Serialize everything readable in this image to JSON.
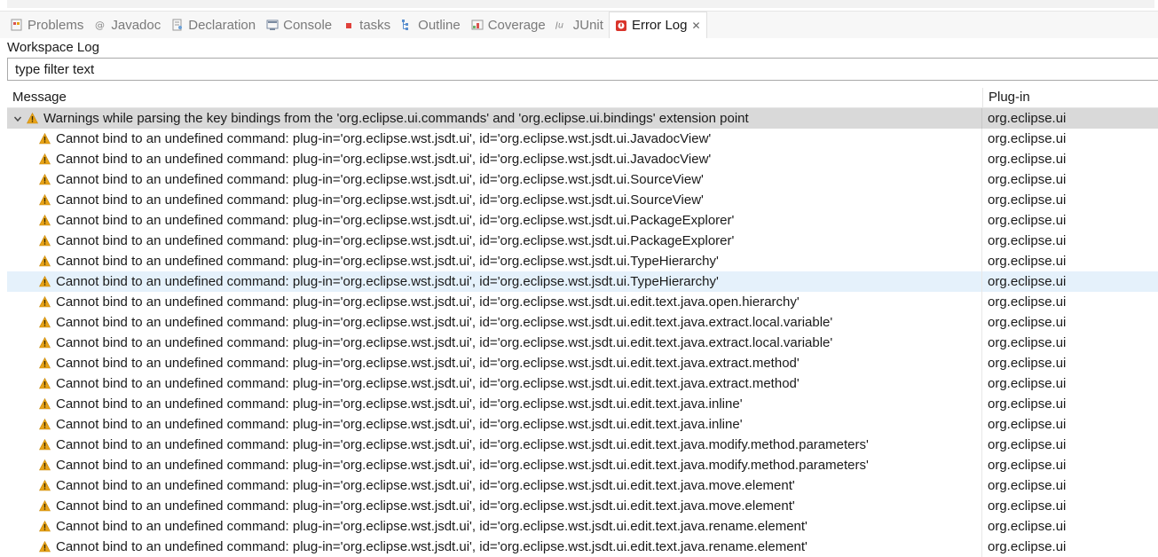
{
  "tabs": [
    {
      "label": "Problems",
      "icon": "problems-icon",
      "active": false
    },
    {
      "label": "Javadoc",
      "icon": "javadoc-icon",
      "active": false
    },
    {
      "label": "Declaration",
      "icon": "declaration-icon",
      "active": false
    },
    {
      "label": "Console",
      "icon": "console-icon",
      "active": false
    },
    {
      "label": "tasks",
      "icon": "tasks-icon",
      "active": false
    },
    {
      "label": "Outline",
      "icon": "outline-icon",
      "active": false
    },
    {
      "label": "Coverage",
      "icon": "coverage-icon",
      "active": false
    },
    {
      "label": "JUnit",
      "icon": "junit-icon",
      "active": false
    },
    {
      "label": "Error Log",
      "icon": "error-log-icon",
      "active": true
    }
  ],
  "panel": {
    "title": "Workspace Log",
    "filter_text": "type filter text"
  },
  "table": {
    "columns": {
      "message": "Message",
      "plugin": "Plug-in"
    },
    "group": {
      "message": "Warnings while parsing the key bindings from the 'org.eclipse.ui.commands' and 'org.eclipse.ui.bindings' extension point",
      "plugin": "org.eclipse.ui",
      "expanded": true
    },
    "rows": [
      {
        "message": "Cannot bind to an undefined command: plug-in='org.eclipse.wst.jsdt.ui', id='org.eclipse.wst.jsdt.ui.JavadocView'",
        "plugin": "org.eclipse.ui"
      },
      {
        "message": "Cannot bind to an undefined command: plug-in='org.eclipse.wst.jsdt.ui', id='org.eclipse.wst.jsdt.ui.JavadocView'",
        "plugin": "org.eclipse.ui"
      },
      {
        "message": "Cannot bind to an undefined command: plug-in='org.eclipse.wst.jsdt.ui', id='org.eclipse.wst.jsdt.ui.SourceView'",
        "plugin": "org.eclipse.ui"
      },
      {
        "message": "Cannot bind to an undefined command: plug-in='org.eclipse.wst.jsdt.ui', id='org.eclipse.wst.jsdt.ui.SourceView'",
        "plugin": "org.eclipse.ui"
      },
      {
        "message": "Cannot bind to an undefined command: plug-in='org.eclipse.wst.jsdt.ui', id='org.eclipse.wst.jsdt.ui.PackageExplorer'",
        "plugin": "org.eclipse.ui"
      },
      {
        "message": "Cannot bind to an undefined command: plug-in='org.eclipse.wst.jsdt.ui', id='org.eclipse.wst.jsdt.ui.PackageExplorer'",
        "plugin": "org.eclipse.ui"
      },
      {
        "message": "Cannot bind to an undefined command: plug-in='org.eclipse.wst.jsdt.ui', id='org.eclipse.wst.jsdt.ui.TypeHierarchy'",
        "plugin": "org.eclipse.ui"
      },
      {
        "message": "Cannot bind to an undefined command: plug-in='org.eclipse.wst.jsdt.ui', id='org.eclipse.wst.jsdt.ui.TypeHierarchy'",
        "plugin": "org.eclipse.ui",
        "selected": true
      },
      {
        "message": "Cannot bind to an undefined command: plug-in='org.eclipse.wst.jsdt.ui', id='org.eclipse.wst.jsdt.ui.edit.text.java.open.hierarchy'",
        "plugin": "org.eclipse.ui"
      },
      {
        "message": "Cannot bind to an undefined command: plug-in='org.eclipse.wst.jsdt.ui', id='org.eclipse.wst.jsdt.ui.edit.text.java.extract.local.variable'",
        "plugin": "org.eclipse.ui"
      },
      {
        "message": "Cannot bind to an undefined command: plug-in='org.eclipse.wst.jsdt.ui', id='org.eclipse.wst.jsdt.ui.edit.text.java.extract.local.variable'",
        "plugin": "org.eclipse.ui"
      },
      {
        "message": "Cannot bind to an undefined command: plug-in='org.eclipse.wst.jsdt.ui', id='org.eclipse.wst.jsdt.ui.edit.text.java.extract.method'",
        "plugin": "org.eclipse.ui"
      },
      {
        "message": "Cannot bind to an undefined command: plug-in='org.eclipse.wst.jsdt.ui', id='org.eclipse.wst.jsdt.ui.edit.text.java.extract.method'",
        "plugin": "org.eclipse.ui"
      },
      {
        "message": "Cannot bind to an undefined command: plug-in='org.eclipse.wst.jsdt.ui', id='org.eclipse.wst.jsdt.ui.edit.text.java.inline'",
        "plugin": "org.eclipse.ui"
      },
      {
        "message": "Cannot bind to an undefined command: plug-in='org.eclipse.wst.jsdt.ui', id='org.eclipse.wst.jsdt.ui.edit.text.java.inline'",
        "plugin": "org.eclipse.ui"
      },
      {
        "message": "Cannot bind to an undefined command: plug-in='org.eclipse.wst.jsdt.ui', id='org.eclipse.wst.jsdt.ui.edit.text.java.modify.method.parameters'",
        "plugin": "org.eclipse.ui"
      },
      {
        "message": "Cannot bind to an undefined command: plug-in='org.eclipse.wst.jsdt.ui', id='org.eclipse.wst.jsdt.ui.edit.text.java.modify.method.parameters'",
        "plugin": "org.eclipse.ui"
      },
      {
        "message": "Cannot bind to an undefined command: plug-in='org.eclipse.wst.jsdt.ui', id='org.eclipse.wst.jsdt.ui.edit.text.java.move.element'",
        "plugin": "org.eclipse.ui"
      },
      {
        "message": "Cannot bind to an undefined command: plug-in='org.eclipse.wst.jsdt.ui', id='org.eclipse.wst.jsdt.ui.edit.text.java.move.element'",
        "plugin": "org.eclipse.ui"
      },
      {
        "message": "Cannot bind to an undefined command: plug-in='org.eclipse.wst.jsdt.ui', id='org.eclipse.wst.jsdt.ui.edit.text.java.rename.element'",
        "plugin": "org.eclipse.ui"
      },
      {
        "message": "Cannot bind to an undefined command: plug-in='org.eclipse.wst.jsdt.ui', id='org.eclipse.wst.jsdt.ui.edit.text.java.rename.element'",
        "plugin": "org.eclipse.ui"
      }
    ]
  },
  "colors": {
    "warning": "#e8a317",
    "group_row_bg": "#d9d9d9",
    "selected_row_bg": "#e5f1fb",
    "error_log_icon": "#d9342b"
  }
}
